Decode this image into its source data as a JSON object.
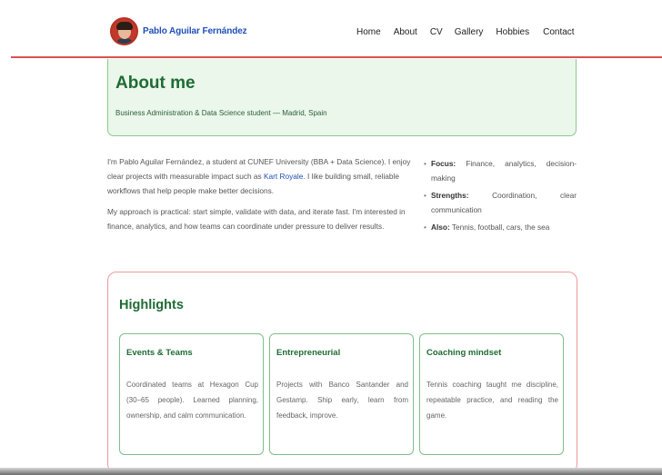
{
  "header": {
    "name": "Pablo Aguilar Fernández",
    "nav": [
      "Home",
      "About",
      "CV",
      "Gallery",
      "Hobbies",
      "Contact"
    ]
  },
  "about": {
    "title": "About me",
    "subtitle": "Business Administration & Data Science student — Madrid, Spain"
  },
  "intro": {
    "p1_before": "I'm Pablo Aguilar Fernández, a student at CUNEF University (BBA + Data Science). I enjoy clear projects with measurable impact such as ",
    "p1_link": "Kart Royale",
    "p1_after": ". I like building small, reliable workflows that help people make better decisions.",
    "p2": "My approach is practical: start simple, validate with data, and iterate fast. I'm interested in finance, analytics, and how teams can coordinate under pressure to deliver results."
  },
  "bullets": [
    {
      "label": "Focus:",
      "text": "Finance, analytics, decision-making"
    },
    {
      "label": "Strengths:",
      "text": "Coordination, clear communication"
    },
    {
      "label": "Also:",
      "text": "Tennis, football, cars, the sea"
    }
  ],
  "highlights": {
    "title": "Highlights",
    "cards": [
      {
        "title": "Events & Teams",
        "body": "Coordinated teams at Hexagon Cup (30–65 people). Learned planning, ownership, and calm communication."
      },
      {
        "title": "Entrepreneurial",
        "body": "Projects with Banco Santander and Gestamp. Ship early, learn from feedback, improve."
      },
      {
        "title": "Coaching mindset",
        "body": "Tennis coaching taught me discipline, repeatable practice, and reading the game."
      }
    ]
  },
  "colors": {
    "accent_green": "#1f6b35",
    "link_blue": "#1f4fb8",
    "header_rule": "#d9534f"
  },
  "icons": {
    "avatar": "profile-photo"
  }
}
